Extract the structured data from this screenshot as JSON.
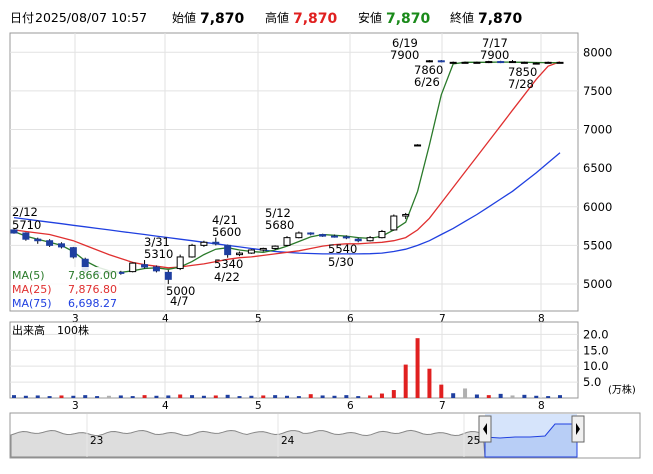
{
  "header": {
    "datetime_label": "日付",
    "datetime": "2025/08/07 10:57",
    "open_label": "始値",
    "open": "7,870",
    "high_label": "高値",
    "high": "7,870",
    "low_label": "安値",
    "low": "7,870",
    "close_label": "終値",
    "close": "7,870"
  },
  "colors": {
    "up": "#000000",
    "down": "#1f3fa0",
    "ma5": "#2a7a2a",
    "ma25": "#e03030",
    "ma75": "#2040e0",
    "high": "#e02020",
    "low": "#1a8a1a",
    "volume_red": "#e02020",
    "volume_blue": "#1f3fa0",
    "volume_gray": "#b0b0b0",
    "nav_fill": "#c8d8f8",
    "nav_line": "#2040e0"
  },
  "chart_data": [
    {
      "type": "candlestick",
      "y_ticks": [
        5000,
        5500,
        6000,
        6500,
        7000,
        7500,
        8000
      ],
      "ylim": [
        4650,
        8250
      ],
      "x_ticks": [
        "3",
        "4",
        "5",
        "6",
        "7",
        "8"
      ],
      "grid": true,
      "annotations": [
        {
          "date": "2/12",
          "value": "5710"
        },
        {
          "date": "3/31",
          "value": "5310"
        },
        {
          "date": "4/7",
          "value": "5000"
        },
        {
          "date": "4/21",
          "value": "5600"
        },
        {
          "date": "4/22",
          "value": "5340"
        },
        {
          "date": "5/12",
          "value": "5680"
        },
        {
          "date": "5/30",
          "value": "5540"
        },
        {
          "date": "6/19",
          "value": "7900"
        },
        {
          "date": "6/26",
          "value": "7860"
        },
        {
          "date": "7/17",
          "value": "7900"
        },
        {
          "date": "7/28",
          "value": "7850"
        }
      ],
      "legend": [
        {
          "label": "MA(5)",
          "value": "7,866.00",
          "color": "#2a7a2a"
        },
        {
          "label": "MA(25)",
          "value": "7,876.80",
          "color": "#e03030"
        },
        {
          "label": "MA(75)",
          "value": "6,698.27",
          "color": "#2040e0"
        }
      ],
      "candles": [
        {
          "x": "2/12",
          "o": 5700,
          "h": 5710,
          "l": 5650,
          "c": 5660
        },
        {
          "x": "2/14",
          "o": 5660,
          "h": 5670,
          "l": 5560,
          "c": 5580
        },
        {
          "x": "2/18",
          "o": 5580,
          "h": 5600,
          "l": 5520,
          "c": 5560
        },
        {
          "x": "2/21",
          "o": 5560,
          "h": 5580,
          "l": 5480,
          "c": 5500
        },
        {
          "x": "2/26",
          "o": 5520,
          "h": 5540,
          "l": 5460,
          "c": 5480
        },
        {
          "x": "3/3",
          "o": 5470,
          "h": 5480,
          "l": 5330,
          "c": 5350
        },
        {
          "x": "3/7",
          "o": 5320,
          "h": 5340,
          "l": 5150,
          "c": 5180
        },
        {
          "x": "3/12",
          "o": 5150,
          "h": 5180,
          "l": 5120,
          "c": 5140
        },
        {
          "x": "3/17",
          "o": 5140,
          "h": 5160,
          "l": 5110,
          "c": 5150
        },
        {
          "x": "3/21",
          "o": 5150,
          "h": 5170,
          "l": 5120,
          "c": 5140
        },
        {
          "x": "3/26",
          "o": 5160,
          "h": 5280,
          "l": 5150,
          "c": 5270
        },
        {
          "x": "3/31",
          "o": 5250,
          "h": 5310,
          "l": 5200,
          "c": 5220
        },
        {
          "x": "4/3",
          "o": 5220,
          "h": 5240,
          "l": 5150,
          "c": 5170
        },
        {
          "x": "4/7",
          "o": 5150,
          "h": 5180,
          "l": 5000,
          "c": 5060
        },
        {
          "x": "4/10",
          "o": 5200,
          "h": 5380,
          "l": 5180,
          "c": 5350
        },
        {
          "x": "4/14",
          "o": 5350,
          "h": 5520,
          "l": 5340,
          "c": 5500
        },
        {
          "x": "4/17",
          "o": 5500,
          "h": 5560,
          "l": 5480,
          "c": 5540
        },
        {
          "x": "4/21",
          "o": 5540,
          "h": 5600,
          "l": 5500,
          "c": 5520
        },
        {
          "x": "4/22",
          "o": 5500,
          "h": 5510,
          "l": 5340,
          "c": 5380
        },
        {
          "x": "4/25",
          "o": 5380,
          "h": 5420,
          "l": 5360,
          "c": 5400
        },
        {
          "x": "4/30",
          "o": 5400,
          "h": 5450,
          "l": 5390,
          "c": 5440
        },
        {
          "x": "5/2",
          "o": 5440,
          "h": 5470,
          "l": 5420,
          "c": 5460
        },
        {
          "x": "5/7",
          "o": 5460,
          "h": 5500,
          "l": 5440,
          "c": 5490
        },
        {
          "x": "5/9",
          "o": 5500,
          "h": 5620,
          "l": 5490,
          "c": 5600
        },
        {
          "x": "5/12",
          "o": 5600,
          "h": 5680,
          "l": 5590,
          "c": 5660
        },
        {
          "x": "5/15",
          "o": 5660,
          "h": 5670,
          "l": 5630,
          "c": 5650
        },
        {
          "x": "5/19",
          "o": 5640,
          "h": 5650,
          "l": 5610,
          "c": 5620
        },
        {
          "x": "5/22",
          "o": 5620,
          "h": 5640,
          "l": 5600,
          "c": 5610
        },
        {
          "x": "5/26",
          "o": 5610,
          "h": 5630,
          "l": 5580,
          "c": 5600
        },
        {
          "x": "5/30",
          "o": 5580,
          "h": 5600,
          "l": 5540,
          "c": 5560
        },
        {
          "x": "6/3",
          "o": 5560,
          "h": 5620,
          "l": 5550,
          "c": 5600
        },
        {
          "x": "6/6",
          "o": 5600,
          "h": 5700,
          "l": 5590,
          "c": 5680
        },
        {
          "x": "6/10",
          "o": 5700,
          "h": 5900,
          "l": 5690,
          "c": 5880
        },
        {
          "x": "6/12",
          "o": 5880,
          "h": 5920,
          "l": 5840,
          "c": 5900
        },
        {
          "x": "6/16",
          "o": 6800,
          "h": 6810,
          "l": 6790,
          "c": 6800
        },
        {
          "x": "6/19",
          "o": 7880,
          "h": 7900,
          "l": 7870,
          "c": 7890
        },
        {
          "x": "6/23",
          "o": 7890,
          "h": 7900,
          "l": 7870,
          "c": 7880
        },
        {
          "x": "6/26",
          "o": 7870,
          "h": 7880,
          "l": 7860,
          "c": 7870
        },
        {
          "x": "7/1",
          "o": 7870,
          "h": 7880,
          "l": 7860,
          "c": 7870
        },
        {
          "x": "7/4",
          "o": 7870,
          "h": 7880,
          "l": 7860,
          "c": 7870
        },
        {
          "x": "7/9",
          "o": 7870,
          "h": 7890,
          "l": 7860,
          "c": 7880
        },
        {
          "x": "7/14",
          "o": 7880,
          "h": 7890,
          "l": 7860,
          "c": 7870
        },
        {
          "x": "7/17",
          "o": 7880,
          "h": 7900,
          "l": 7870,
          "c": 7880
        },
        {
          "x": "7/22",
          "o": 7870,
          "h": 7880,
          "l": 7860,
          "c": 7870
        },
        {
          "x": "7/28",
          "o": 7860,
          "h": 7870,
          "l": 7850,
          "c": 7860
        },
        {
          "x": "8/1",
          "o": 7860,
          "h": 7880,
          "l": 7860,
          "c": 7870
        },
        {
          "x": "8/7",
          "o": 7870,
          "h": 7870,
          "l": 7870,
          "c": 7870
        }
      ],
      "ma5": [
        5680,
        5620,
        5580,
        5540,
        5500,
        5420,
        5300,
        5220,
        5170,
        5150,
        5170,
        5200,
        5210,
        5190,
        5220,
        5290,
        5380,
        5450,
        5470,
        5440,
        5420,
        5410,
        5440,
        5490,
        5550,
        5610,
        5640,
        5630,
        5620,
        5600,
        5590,
        5620,
        5700,
        5800,
        6200,
        6800,
        7450,
        7850,
        7870,
        7870,
        7870,
        7875,
        7872,
        7870,
        7868,
        7866,
        7866
      ],
      "ma25": [
        5700,
        5680,
        5660,
        5640,
        5600,
        5560,
        5500,
        5440,
        5380,
        5330,
        5280,
        5250,
        5230,
        5210,
        5220,
        5240,
        5260,
        5290,
        5320,
        5340,
        5350,
        5370,
        5390,
        5410,
        5430,
        5460,
        5490,
        5510,
        5520,
        5520,
        5530,
        5540,
        5560,
        5600,
        5700,
        5850,
        6050,
        6250,
        6450,
        6650,
        6850,
        7050,
        7250,
        7450,
        7650,
        7820,
        7877
      ],
      "ma75": [
        5860,
        5840,
        5820,
        5800,
        5780,
        5760,
        5740,
        5720,
        5700,
        5680,
        5660,
        5640,
        5620,
        5600,
        5580,
        5560,
        5540,
        5520,
        5500,
        5480,
        5460,
        5440,
        5420,
        5410,
        5400,
        5395,
        5390,
        5390,
        5390,
        5390,
        5392,
        5400,
        5420,
        5450,
        5500,
        5560,
        5640,
        5720,
        5810,
        5900,
        6000,
        6100,
        6200,
        6320,
        6440,
        6570,
        6698
      ]
    },
    {
      "type": "bar",
      "title": "出来高",
      "unit_label": "100株",
      "y_ticks": [
        5.0,
        10.0,
        15.0,
        20.0
      ],
      "ylim": [
        0,
        22
      ],
      "y_unit": "(万株)",
      "values": [
        0.9,
        0.7,
        0.8,
        0.6,
        0.8,
        0.7,
        0.9,
        0.6,
        0.7,
        0.8,
        0.6,
        0.9,
        0.7,
        0.8,
        1.1,
        0.9,
        0.7,
        0.8,
        1.0,
        0.6,
        0.7,
        0.8,
        0.9,
        0.7,
        0.6,
        1.2,
        0.8,
        0.7,
        0.9,
        0.6,
        0.8,
        1.4,
        2.5,
        10.5,
        18.8,
        9.2,
        4.2,
        1.5,
        3.0,
        1.1,
        0.9,
        1.3,
        0.8,
        1.0,
        0.7,
        0.6,
        0.9
      ],
      "colors": [
        "b",
        "b",
        "b",
        "b",
        "r",
        "b",
        "b",
        "b",
        "g",
        "b",
        "b",
        "r",
        "b",
        "b",
        "r",
        "b",
        "b",
        "r",
        "b",
        "b",
        "b",
        "r",
        "b",
        "b",
        "b",
        "r",
        "b",
        "b",
        "b",
        "b",
        "r",
        "r",
        "r",
        "r",
        "r",
        "r",
        "r",
        "b",
        "g",
        "b",
        "r",
        "b",
        "g",
        "b",
        "b",
        "b",
        "b"
      ]
    },
    {
      "type": "area",
      "x_ticks": [
        "23",
        "24",
        "25"
      ]
    }
  ]
}
